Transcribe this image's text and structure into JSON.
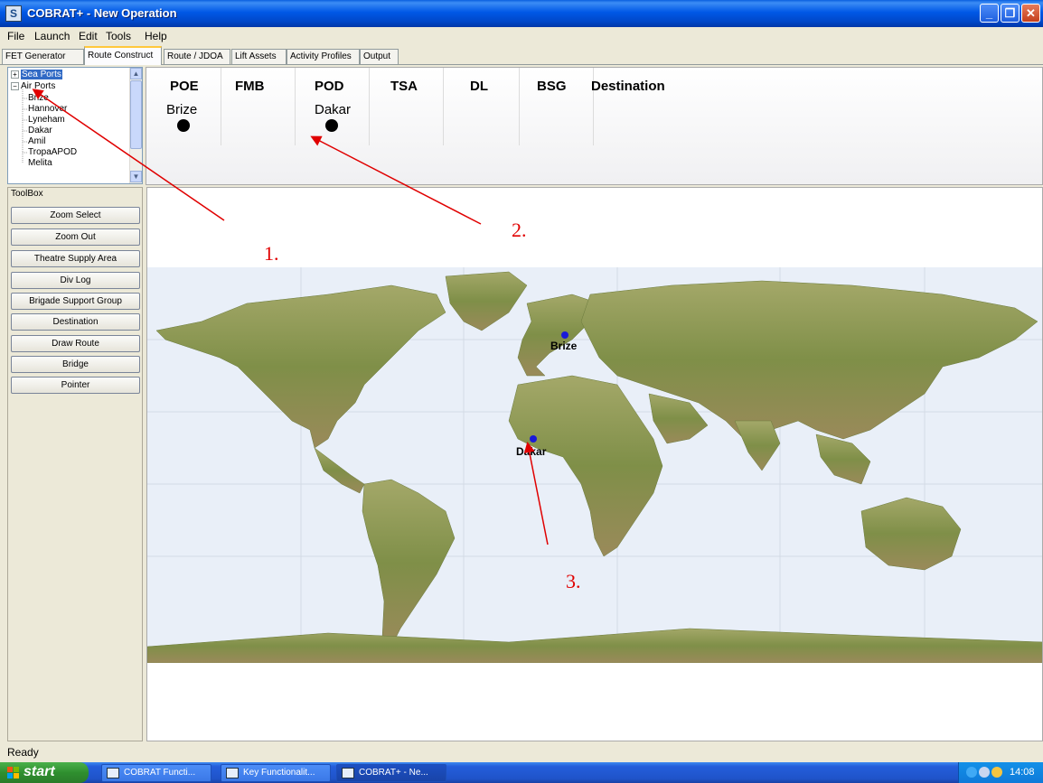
{
  "window": {
    "title": "COBRAT+ - New Operation",
    "icon": "S",
    "controls": {
      "minimize": "_",
      "maximize": "❐",
      "close": "✕"
    }
  },
  "menu": [
    "File",
    "Launch",
    "Edit",
    "Tools",
    "Help"
  ],
  "tabs": [
    {
      "label": "FET Generator",
      "active": false
    },
    {
      "label": "Route Construct",
      "active": true
    },
    {
      "label": "Route / JDOA",
      "active": false
    },
    {
      "label": "Lift Assets",
      "active": false
    },
    {
      "label": "Activity Profiles",
      "active": false
    },
    {
      "label": "Output",
      "active": false
    }
  ],
  "tree": {
    "sea_ports": "Sea Ports",
    "air_ports": "Air Ports",
    "air_port_items": [
      "Brize",
      "Hannover",
      "Lyneham",
      "Dakar",
      "Amil",
      "TropaAPOD",
      "Melita"
    ],
    "expand_plus": "+",
    "expand_minus": "−"
  },
  "route": {
    "columns": [
      "POE",
      "FMB",
      "POD",
      "TSA",
      "DL",
      "BSG",
      "Destination"
    ],
    "values": {
      "POE": "Brize",
      "POD": "Dakar"
    }
  },
  "toolbox": {
    "label": "ToolBox",
    "buttons": [
      "Zoom Select",
      "Zoom Out",
      "Theatre Supply Area",
      "Div Log",
      "Brigade Support Group",
      "Destination",
      "Draw Route",
      "Bridge",
      "Pointer"
    ]
  },
  "map": {
    "cities": [
      {
        "name": "Brize",
        "color": "#1a1ad8"
      },
      {
        "name": "Dakar",
        "color": "#1a1ad8"
      }
    ],
    "ocean_color": "#e9eff8",
    "land_color": "#8a9a52"
  },
  "annotations": [
    {
      "label": "1.",
      "color": "#e00000"
    },
    {
      "label": "2.",
      "color": "#e00000"
    },
    {
      "label": "3.",
      "color": "#e00000"
    }
  ],
  "status": "Ready",
  "taskbar": {
    "start": "start",
    "items": [
      {
        "label": "COBRAT Functi...",
        "active": false
      },
      {
        "label": "Key Functionalit...",
        "active": false
      },
      {
        "label": "COBRAT+ - Ne...",
        "active": true
      }
    ],
    "clock": "14:08"
  }
}
